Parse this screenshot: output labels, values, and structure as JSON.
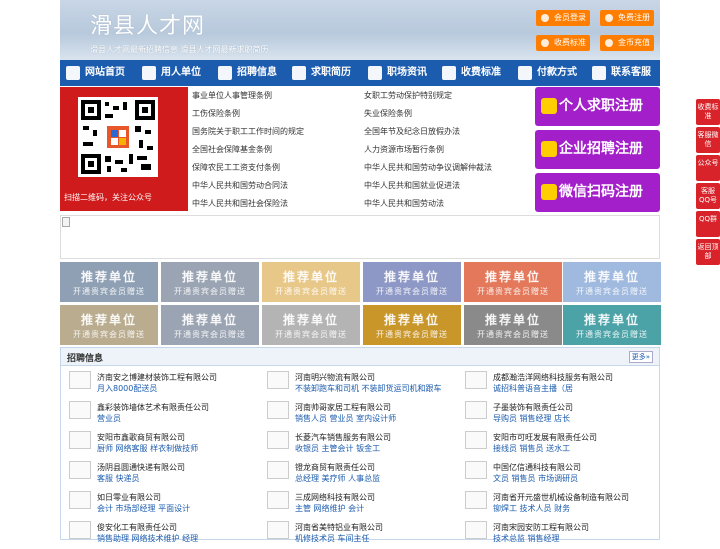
{
  "header": {
    "logo": "滑县人才网",
    "subtitle": "滑县人才网最新招聘信息   滑县人才网最新求职简历",
    "buttons": {
      "login": "会员登录",
      "register": "免费注册",
      "pricing": "收费标准",
      "recharge": "金币充值"
    }
  },
  "nav": [
    "网站首页",
    "用人单位",
    "招聘信息",
    "求职简历",
    "职场资讯",
    "收费标准",
    "付款方式",
    "联系客服"
  ],
  "qr": {
    "caption": "扫描二维码，关注公众号"
  },
  "links": {
    "left": [
      "事业单位人事管理条例",
      "工伤保险条例",
      "国务院关于职工工作时间的规定",
      "全国社会保障基金条例",
      "保障农民工工资支付条例",
      "中华人民共和国劳动合同法",
      "中华人民共和国社会保险法"
    ],
    "right": [
      "女职工劳动保护特别规定",
      "失业保险条例",
      "全国年节及纪念日放假办法",
      "人力资源市场暂行条例",
      "中华人民共和国劳动争议调解仲裁法",
      "中华人民共和国就业促进法",
      "中华人民共和国劳动法"
    ]
  },
  "register_buttons": {
    "jobseeker": "个人求职注册",
    "company": "企业招聘注册",
    "wechat": "微信扫码注册"
  },
  "side_tools": [
    "收费标准",
    "客服微信",
    "公众号",
    "客服QQ号",
    "QQ群",
    "返回顶部"
  ],
  "recommend": {
    "title": "推荐单位",
    "subtitle": "开通贵宾会员赠送"
  },
  "recommend_colors": [
    "#8fa0b4",
    "#9aa4b3",
    "#e8c889",
    "#8d98c6",
    "#e3785a",
    "#9fb9df",
    "#b9ac8f",
    "#9aa4b3",
    "#b4b4b4",
    "#c9962a",
    "#8a8a8a",
    "#4ba3a7"
  ],
  "jobs_section": {
    "title": "招聘信息",
    "more": "更多»",
    "items": [
      {
        "company": "济南安之博建材装饰工程有限公司",
        "positions": "月入8000配送员"
      },
      {
        "company": "河南明兴物流有限公司",
        "positions": "不装卸跑车和司机 不装卸货运司机和跟车"
      },
      {
        "company": "成都瀚浩洋网络科技服务有限公司",
        "positions": "诚招科普语音主播（居"
      },
      {
        "company": "鑫彩装饰墙体艺术有限责任公司",
        "positions": "营业员"
      },
      {
        "company": "河南帅哥家居工程有限公司",
        "positions": "销售人员 营业员 室内设计师"
      },
      {
        "company": "子墨装饰有限责任公司",
        "positions": "导购员 销售经理 店长"
      },
      {
        "company": "安阳市鑫歌商贸有限公司",
        "positions": "厨师 网络客服 样衣制做技师"
      },
      {
        "company": "长菱汽车销售服务有限公司",
        "positions": "收银员 主管会计 钣金工"
      },
      {
        "company": "安阳市可旺发展有限责任公司",
        "positions": "接线员 销售员 送水工"
      },
      {
        "company": "汤阴县圆通快递有限公司",
        "positions": "客服 快递员"
      },
      {
        "company": "镫龙商贸有限责任公司",
        "positions": "总经理 美疗师 人事总监"
      },
      {
        "company": "中国亿信通科技有限公司",
        "positions": "文员 销售员 市场调研员"
      },
      {
        "company": "如日零业有限公司",
        "positions": "会计 市场部经理 平面设计"
      },
      {
        "company": "三成网络科技有限公司",
        "positions": "主管 网络维护 会计"
      },
      {
        "company": "河南省开元盛世机械设备制造有限公司",
        "positions": "铆焊工 技术人员 财务"
      },
      {
        "company": "俊安化工有限责任公司",
        "positions": "销售助理 网络技术维护 经理"
      },
      {
        "company": "河南省美特铝业有限公司",
        "positions": "机修技术员 车间主任"
      },
      {
        "company": "河南宋园安防工程有限公司",
        "positions": "技术总监 销售经理"
      }
    ]
  }
}
